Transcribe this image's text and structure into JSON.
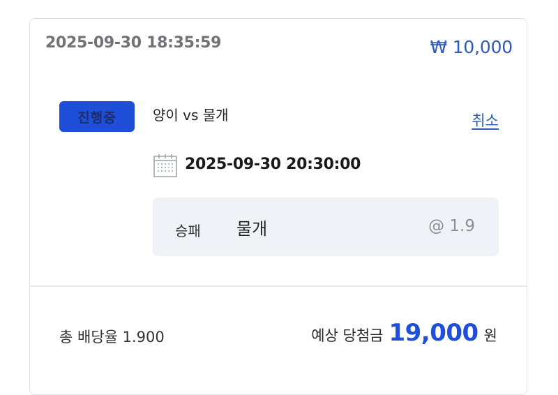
{
  "bet": {
    "placed_at": "2025-09-30 18:35:59",
    "stake": "₩ 10,000"
  },
  "match": {
    "status": "진행중",
    "name": "양이 vs 물개",
    "cancel_label": "취소",
    "start_time": "2025-09-30 20:30:00",
    "icon": "calendar-icon"
  },
  "pick": {
    "market": "승패",
    "selection": "물개",
    "odds": "@ 1.9"
  },
  "summary": {
    "total_odds": "총 배당율 1.900",
    "expected_label": "예상 당첨금",
    "expected_amount": "19,000",
    "expected_unit": "원"
  },
  "colors": {
    "accent": "#1f4fd8",
    "link": "#2d5bb5",
    "pick_bg": "#eff2f7"
  }
}
